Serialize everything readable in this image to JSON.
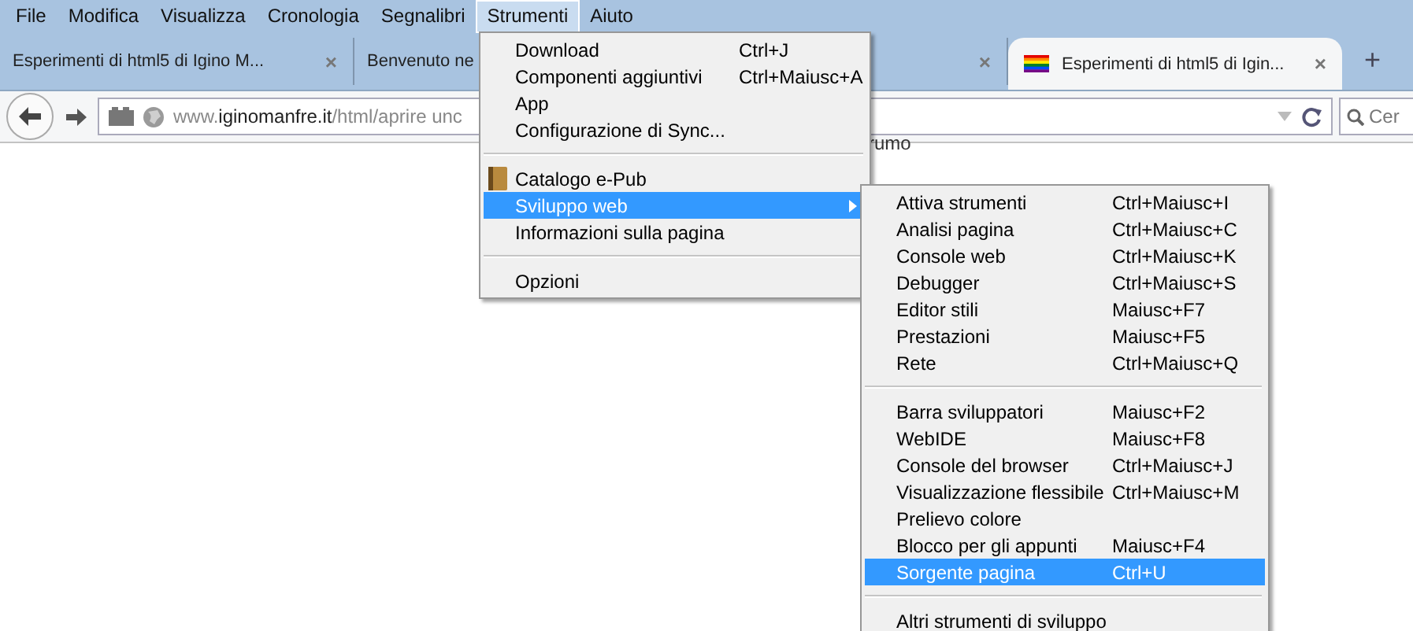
{
  "menu_bar": [
    {
      "label": "File",
      "selected": false
    },
    {
      "label": "Modifica",
      "selected": false
    },
    {
      "label": "Visualizza",
      "selected": false
    },
    {
      "label": "Cronologia",
      "selected": false
    },
    {
      "label": "Segnalibri",
      "selected": false
    },
    {
      "label": "Strumenti",
      "selected": true
    },
    {
      "label": "Aiuto",
      "selected": false
    }
  ],
  "tabs": [
    {
      "title": "Esperimenti di html5 di Igino M...",
      "close": "×",
      "selected": false,
      "favicon": false
    },
    {
      "title": "Benvenuto ne",
      "close": "×",
      "selected": false,
      "favicon": false
    },
    {
      "title": "Esperimenti di html5 di Igin...",
      "close": "×",
      "selected": true,
      "favicon": true
    }
  ],
  "new_tab": "+",
  "nav_bar": {
    "url_prefix": "www.",
    "url_domain": "iginomanfre.it",
    "url_path": "/html/aprire unc",
    "search_placeholder": "Cer"
  },
  "page": {
    "text_fragment": "rumo"
  },
  "tools_menu": [
    {
      "kind": "item",
      "label": "Download",
      "shortcut": "Ctrl+J",
      "selected": false
    },
    {
      "kind": "item",
      "label": "Componenti aggiuntivi",
      "shortcut": "Ctrl+Maiusc+A",
      "selected": false
    },
    {
      "kind": "item",
      "label": "App",
      "selected": false
    },
    {
      "kind": "item",
      "label": "Configurazione di Sync...",
      "selected": false
    },
    {
      "kind": "separator"
    },
    {
      "kind": "icon_item",
      "label": "Catalogo e-Pub",
      "selected": false
    },
    {
      "kind": "submenu",
      "label": "Sviluppo web",
      "selected": true
    },
    {
      "kind": "item",
      "label": "Informazioni sulla pagina",
      "selected": false
    },
    {
      "kind": "separator"
    },
    {
      "kind": "item",
      "label": "Opzioni",
      "selected": false
    }
  ],
  "web_dev_submenu": [
    {
      "kind": "item",
      "label": "Attiva strumenti",
      "shortcut": "Ctrl+Maiusc+I",
      "selected": false
    },
    {
      "kind": "item",
      "label": "Analisi pagina",
      "shortcut": "Ctrl+Maiusc+C",
      "selected": false
    },
    {
      "kind": "item",
      "label": "Console web",
      "shortcut": "Ctrl+Maiusc+K",
      "selected": false
    },
    {
      "kind": "item",
      "label": "Debugger",
      "shortcut": "Ctrl+Maiusc+S",
      "selected": false
    },
    {
      "kind": "item",
      "label": "Editor stili",
      "shortcut": "Maiusc+F7",
      "selected": false
    },
    {
      "kind": "item",
      "label": "Prestazioni",
      "shortcut": "Maiusc+F5",
      "selected": false
    },
    {
      "kind": "item",
      "label": "Rete",
      "shortcut": "Ctrl+Maiusc+Q",
      "selected": false
    },
    {
      "kind": "separator"
    },
    {
      "kind": "item",
      "label": "Barra sviluppatori",
      "shortcut": "Maiusc+F2",
      "selected": false
    },
    {
      "kind": "item",
      "label": "WebIDE",
      "shortcut": "Maiusc+F8",
      "selected": false
    },
    {
      "kind": "item",
      "label": "Console del browser",
      "shortcut": "Ctrl+Maiusc+J",
      "selected": false
    },
    {
      "kind": "item",
      "label": "Visualizzazione flessibile",
      "shortcut": "Ctrl+Maiusc+M",
      "selected": false
    },
    {
      "kind": "item",
      "label": "Prelievo colore",
      "selected": false
    },
    {
      "kind": "item",
      "label": "Blocco per gli appunti",
      "shortcut": "Maiusc+F4",
      "selected": false
    },
    {
      "kind": "item",
      "label": "Sorgente pagina",
      "shortcut": "Ctrl+U",
      "selected": true
    },
    {
      "kind": "separator"
    },
    {
      "kind": "item",
      "label": "Altri strumenti di sviluppo",
      "selected": false
    }
  ]
}
